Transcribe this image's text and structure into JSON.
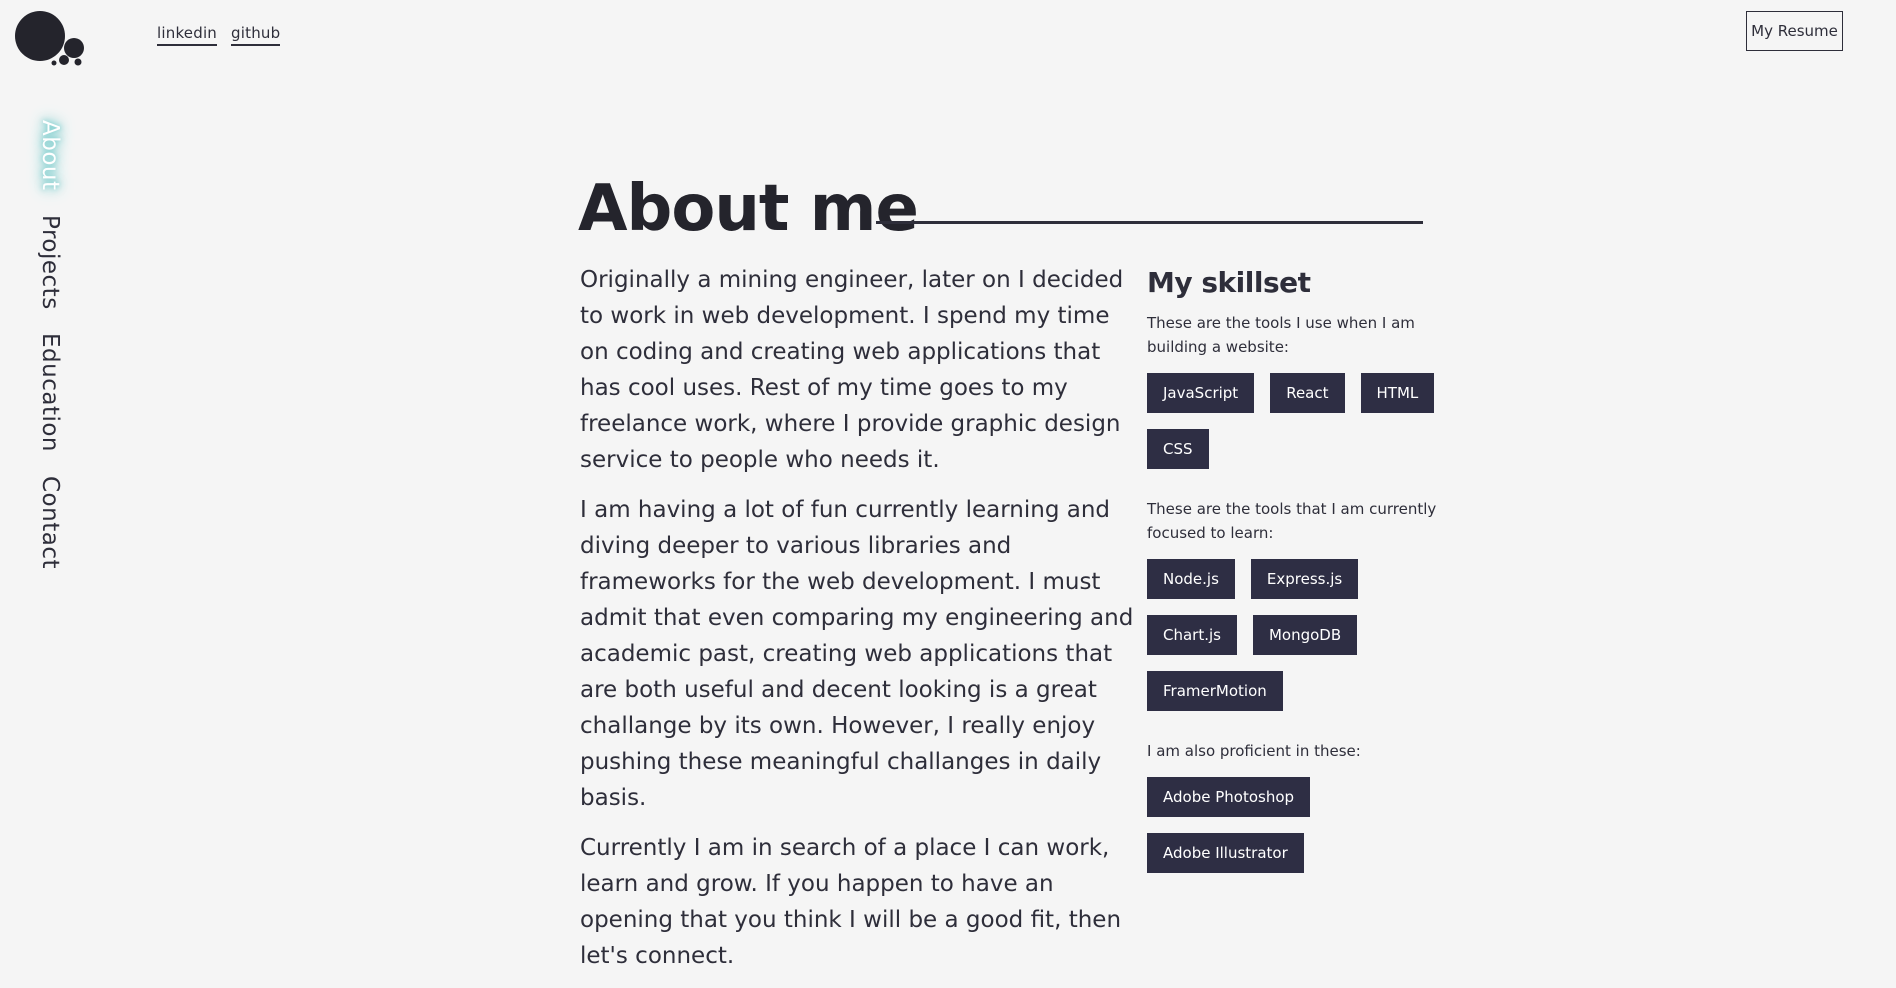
{
  "header": {
    "links": [
      "linkedin",
      "github"
    ],
    "resume_label": "My Resume"
  },
  "sidebar": {
    "items": [
      {
        "label": "About",
        "active": true
      },
      {
        "label": "Projects",
        "active": false
      },
      {
        "label": "Education",
        "active": false
      },
      {
        "label": "Contact",
        "active": false
      }
    ]
  },
  "main": {
    "title": "About me",
    "paragraphs": [
      "Originally a mining engineer, later on I decided to work in web development. I spend my time on coding and creating web applications that has cool uses. Rest of my time goes to my freelance work, where I provide graphic design service to people who needs it.",
      "I am having a lot of fun currently learning and diving deeper to various libraries and frameworks for the web development. I must admit that even comparing my engineering and academic past, creating web applications that are both useful and decent looking is a great challange by its own. However, I really enjoy pushing these meaningful challanges in daily basis.",
      "Currently I am in search of a place I can work, learn and grow. If you happen to have an opening that you think I will be a good fit, then let's connect."
    ]
  },
  "skillset": {
    "title": "My skillset",
    "groups": [
      {
        "description": "These are the tools I use when I am building a website:",
        "tags": [
          "JavaScript",
          "React",
          "HTML",
          "CSS"
        ]
      },
      {
        "description": "These are the tools that I am currently focused to learn:",
        "tags": [
          "Node.js",
          "Express.js",
          "Chart.js",
          "MongoDB",
          "FramerMotion"
        ]
      },
      {
        "description": "I am also proficient in these:",
        "tags": [
          "Adobe Photoshop",
          "Adobe Illustrator"
        ]
      }
    ]
  },
  "colors": {
    "background": "#f5f5f5",
    "text": "#2e2e3a",
    "tag_bg": "#2e2e44",
    "active_glow": "#5fc3c3"
  }
}
